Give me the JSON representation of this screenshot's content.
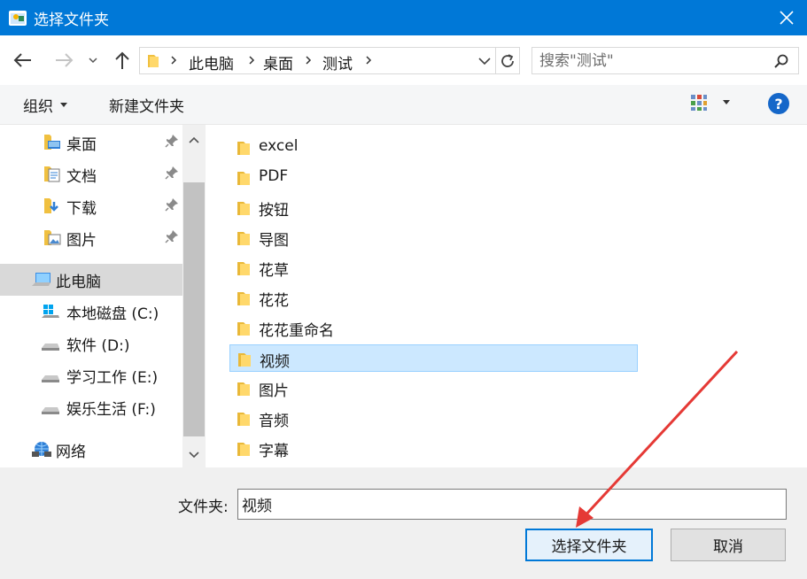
{
  "window": {
    "title": "选择文件夹"
  },
  "breadcrumb": [
    "此电脑",
    "桌面",
    "测试"
  ],
  "search": {
    "placeholder": "搜索\"测试\""
  },
  "toolbar": {
    "organize_label": "组织",
    "new_folder_label": "新建文件夹"
  },
  "sidebar": {
    "items": [
      {
        "label": "桌面",
        "icon": "desktop-folder-icon",
        "pinned": true
      },
      {
        "label": "文档",
        "icon": "documents-folder-icon",
        "pinned": true
      },
      {
        "label": "下载",
        "icon": "downloads-folder-icon",
        "pinned": true
      },
      {
        "label": "图片",
        "icon": "pictures-folder-icon",
        "pinned": true
      },
      {
        "label": "此电脑",
        "icon": "this-pc-icon",
        "selected": true
      },
      {
        "label": "本地磁盘 (C:)",
        "icon": "windows-drive-icon"
      },
      {
        "label": "软件 (D:)",
        "icon": "drive-icon"
      },
      {
        "label": "学习工作 (E:)",
        "icon": "drive-icon"
      },
      {
        "label": "娱乐生活 (F:)",
        "icon": "drive-icon"
      },
      {
        "label": "网络",
        "icon": "network-icon"
      }
    ]
  },
  "files": [
    {
      "name": "excel"
    },
    {
      "name": "PDF"
    },
    {
      "name": "按钮"
    },
    {
      "name": "导图"
    },
    {
      "name": "花草"
    },
    {
      "name": "花花"
    },
    {
      "name": "花花重命名"
    },
    {
      "name": "视频",
      "selected": true
    },
    {
      "name": "图片"
    },
    {
      "name": "音频"
    },
    {
      "name": "字幕"
    }
  ],
  "footer": {
    "folder_label": "文件夹:",
    "folder_value": "视频",
    "select_button": "选择文件夹",
    "cancel_button": "取消"
  },
  "colors": {
    "accent": "#0078d7",
    "selection": "#cce8ff",
    "annotation": "#e53935"
  }
}
